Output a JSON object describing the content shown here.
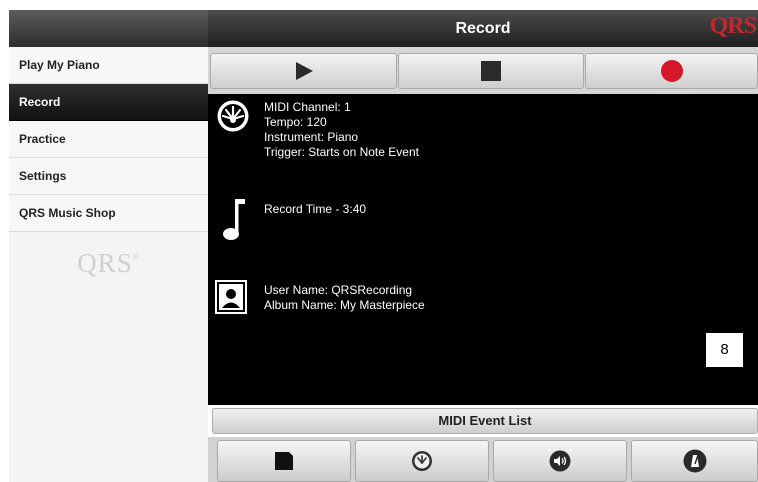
{
  "sidebar": {
    "items": [
      {
        "label": "Play My Piano"
      },
      {
        "label": "Record"
      },
      {
        "label": "Practice"
      },
      {
        "label": "Settings"
      },
      {
        "label": "QRS Music Shop"
      }
    ],
    "active_index": 1,
    "logo_text": "QRS"
  },
  "header": {
    "title": "Record",
    "logo": "QRS",
    "logo_color": "#c4262e"
  },
  "transport": {
    "buttons": [
      {
        "icon": "play-icon"
      },
      {
        "icon": "stop-icon"
      },
      {
        "icon": "record-icon",
        "color": "#d3182c"
      }
    ]
  },
  "session": {
    "midi_channel": "MIDI Channel: 1",
    "tempo": "Tempo: 120",
    "instrument": "Instrument: Piano",
    "trigger": "Trigger: Starts on Note Event",
    "record_time": "Record Time - 3:40",
    "user_name": "User Name: QRSRecording",
    "album_name": "Album Name: My Masterpiece"
  },
  "badge": {
    "value": "8"
  },
  "event_list_label": "MIDI Event List",
  "bottom_buttons": [
    {
      "icon": "save-icon"
    },
    {
      "icon": "tempo-dial-icon"
    },
    {
      "icon": "volume-icon"
    },
    {
      "icon": "metronome-icon"
    }
  ]
}
